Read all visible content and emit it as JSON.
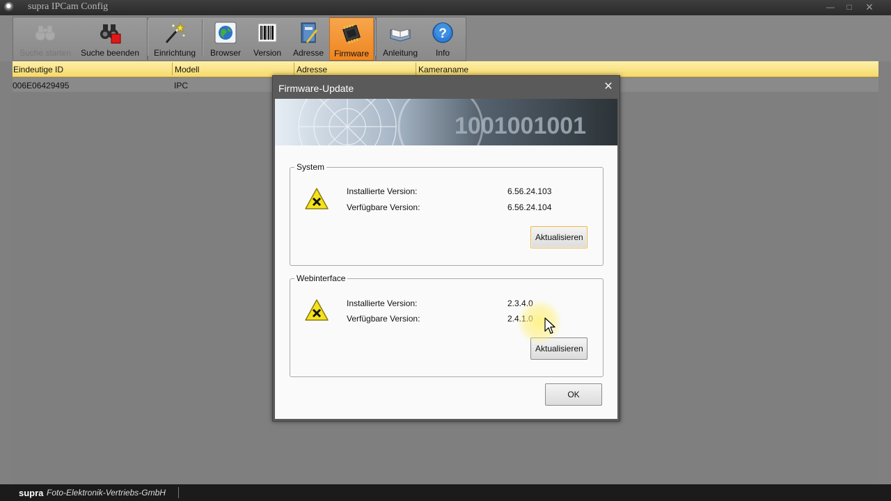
{
  "window": {
    "title": "supra IPCam Config"
  },
  "toolbar": {
    "items": [
      {
        "label": "Suche starten",
        "icon": "binoculars-icon",
        "state": "disabled"
      },
      {
        "label": "Suche beenden",
        "icon": "binoculars-stop-icon",
        "state": "normal"
      },
      {
        "label": "Einrichtung",
        "icon": "magic-wand-icon",
        "state": "normal"
      },
      {
        "label": "Browser",
        "icon": "globe-icon",
        "state": "normal"
      },
      {
        "label": "Version",
        "icon": "barcode-icon",
        "state": "normal"
      },
      {
        "label": "Adresse",
        "icon": "address-book-icon",
        "state": "normal"
      },
      {
        "label": "Firmware",
        "icon": "chip-icon",
        "state": "active"
      },
      {
        "label": "Anleitung",
        "icon": "book-icon",
        "state": "normal"
      },
      {
        "label": "Info",
        "icon": "help-icon",
        "state": "normal"
      }
    ]
  },
  "table": {
    "columns": [
      "Eindeutige ID",
      "Modell",
      "Adresse",
      "Kameraname"
    ],
    "rows": [
      {
        "id": "006E06429495",
        "model": "IPC",
        "address": "",
        "name": ""
      }
    ]
  },
  "dialog": {
    "title": "Firmware-Update",
    "system": {
      "title": "System",
      "installed_label": "Installierte Version:",
      "installed_value": "6.56.24.103",
      "available_label": "Verfügbare Version:",
      "available_value": "6.56.24.104",
      "button": "Aktualisieren"
    },
    "web": {
      "title": "Webinterface",
      "installed_label": "Installierte Version:",
      "installed_value": "2.3.4.0",
      "available_label": "Verfügbare Version:",
      "available_value": "2.4.1.0",
      "button": "Aktualisieren"
    },
    "ok_button": "OK",
    "banner_text": "1001001001"
  },
  "statusbar": {
    "brand": "supra",
    "company": "Foto-Elektronik-Vertriebs-GmbH"
  },
  "colors": {
    "accent": "#f0902a",
    "header": "#f7d96b",
    "dialog_frame": "#5a5a5a"
  }
}
